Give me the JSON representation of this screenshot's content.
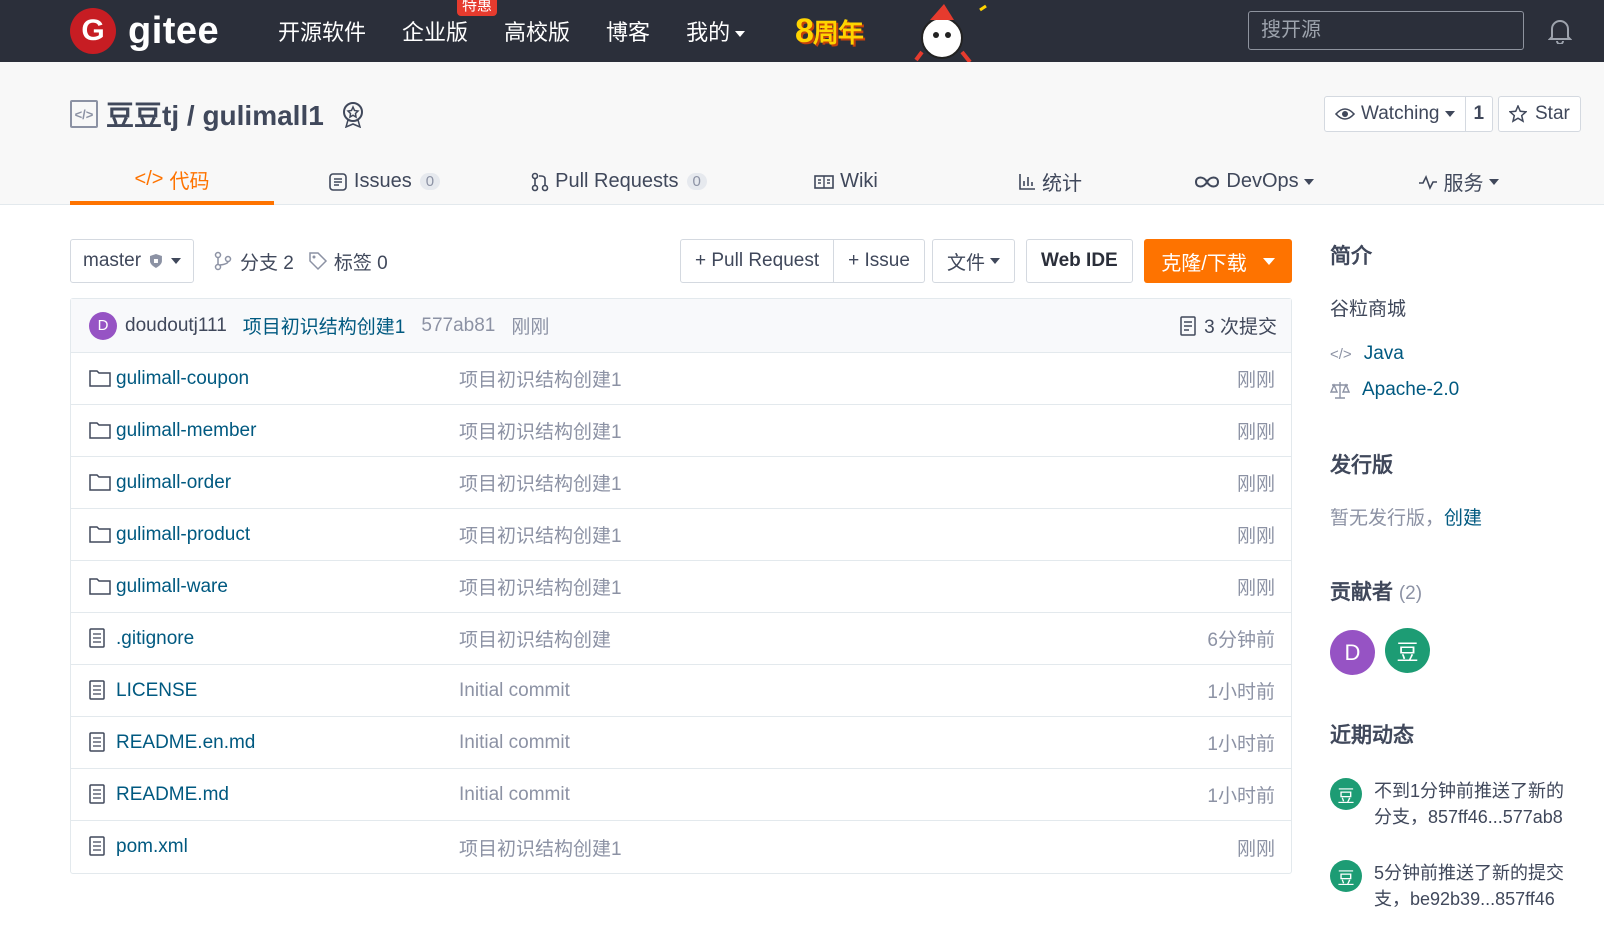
{
  "brand": {
    "logo_letter": "G",
    "name": "gitee"
  },
  "nav": {
    "items": [
      "开源软件",
      "企业版",
      "高校版",
      "博客",
      "我的"
    ],
    "hot_badge": "特惠",
    "anniversary": {
      "digit": "8",
      "text": "周年"
    }
  },
  "search": {
    "placeholder": "搜开源"
  },
  "repo": {
    "owner": "豆豆tj",
    "name": "gulimall1",
    "full_name": "豆豆tj / gulimall1",
    "watch_label": "Watching",
    "watch_count": "1",
    "star_label": "Star"
  },
  "tabs": [
    {
      "label": "代码",
      "active": true
    },
    {
      "label": "Issues",
      "count": "0"
    },
    {
      "label": "Pull Requests",
      "count": "0"
    },
    {
      "label": "Wiki"
    },
    {
      "label": "统计"
    },
    {
      "label": "DevOps"
    },
    {
      "label": "服务"
    }
  ],
  "toolbar": {
    "branch": "master",
    "branches": "分支 2",
    "tags": "标签 0",
    "pull_request": "+ Pull Request",
    "issue": "+ Issue",
    "file": "文件",
    "web_ide": "Web IDE",
    "clone": "克隆/下载"
  },
  "last_commit": {
    "avatar": "D",
    "author": "doudoutj111",
    "message": "项目初识结构创建1",
    "sha": "577ab81",
    "time": "刚刚",
    "commit_count": "3 次提交"
  },
  "files": [
    {
      "type": "folder",
      "name": "gulimall-coupon",
      "message": "项目初识结构创建1",
      "time": "刚刚"
    },
    {
      "type": "folder",
      "name": "gulimall-member",
      "message": "项目初识结构创建1",
      "time": "刚刚"
    },
    {
      "type": "folder",
      "name": "gulimall-order",
      "message": "项目初识结构创建1",
      "time": "刚刚"
    },
    {
      "type": "folder",
      "name": "gulimall-product",
      "message": "项目初识结构创建1",
      "time": "刚刚"
    },
    {
      "type": "folder",
      "name": "gulimall-ware",
      "message": "项目初识结构创建1",
      "time": "刚刚"
    },
    {
      "type": "file",
      "name": ".gitignore",
      "message": "项目初识结构创建",
      "time": "6分钟前"
    },
    {
      "type": "file",
      "name": "LICENSE",
      "message": "Initial commit",
      "time": "1小时前"
    },
    {
      "type": "file",
      "name": "README.en.md",
      "message": "Initial commit",
      "time": "1小时前"
    },
    {
      "type": "file",
      "name": "README.md",
      "message": "Initial commit",
      "time": "1小时前"
    },
    {
      "type": "file",
      "name": "pom.xml",
      "message": "项目初识结构创建1",
      "time": "刚刚"
    }
  ],
  "sidebar": {
    "intro_title": "简介",
    "intro_desc": "谷粒商城",
    "language": "Java",
    "license": "Apache-2.0",
    "release_title": "发行版",
    "release_none": "暂无发行版，",
    "release_create": "创建",
    "contrib_title": "贡献者",
    "contrib_count": "(2)",
    "contributors": [
      {
        "initial": "D",
        "color": "#9653c4"
      },
      {
        "initial": "豆",
        "color": "#1d9c74"
      }
    ],
    "activity_title": "近期动态",
    "activities": [
      {
        "avatar": "豆",
        "line1": "不到1分钟前推送了新的",
        "line2": "分支，857ff46...577ab8"
      },
      {
        "avatar": "豆",
        "line1": "5分钟前推送了新的提交",
        "line2": "支，be92b39...857ff46"
      }
    ]
  },
  "colors": {
    "accent": "#fe7300",
    "link": "#005980",
    "navbar": "#2b2f3a",
    "brand": "#c71d23"
  }
}
